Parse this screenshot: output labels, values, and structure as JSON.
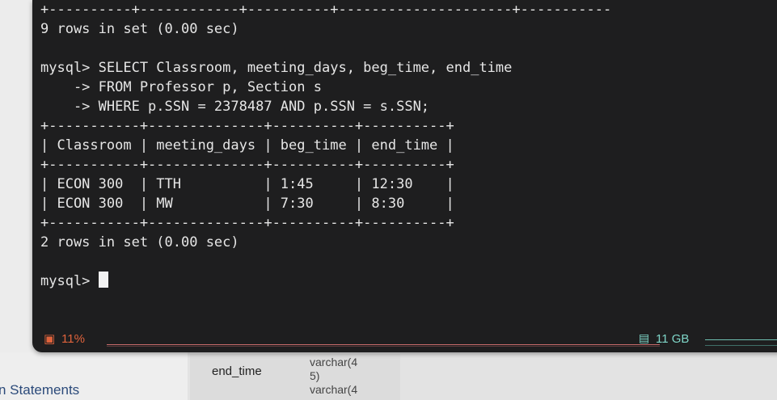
{
  "terminal": {
    "lines": [
      "+----------+------------+----------+---------------------+-----------",
      "9 rows in set (0.00 sec)",
      "",
      "mysql> SELECT Classroom, meeting_days, beg_time, end_time",
      "    -> FROM Professor p, Section s",
      "    -> WHERE p.SSN = 2378487 AND p.SSN = s.SSN;",
      "+-----------+--------------+----------+----------+",
      "| Classroom | meeting_days | beg_time | end_time |",
      "+-----------+--------------+----------+----------+",
      "| ECON 300  | TTH          | 1:45     | 12:30    |",
      "| ECON 300  | MW           | 7:30     | 8:30     |",
      "+-----------+--------------+----------+----------+",
      "2 rows in set (0.00 sec)",
      "",
      "mysql> "
    ]
  },
  "status": {
    "cpu_icon": "cpu-chip-icon",
    "cpu_label": "11%",
    "mem_icon": "memory-icon",
    "mem_label": "11 GB",
    "cpu_color": "#e0633c",
    "mem_color": "#7fd6c8"
  },
  "background": {
    "field_name": "end_time",
    "field_type": "varchar(4\n5)\nvarchar(4",
    "statements": "n Statements"
  }
}
